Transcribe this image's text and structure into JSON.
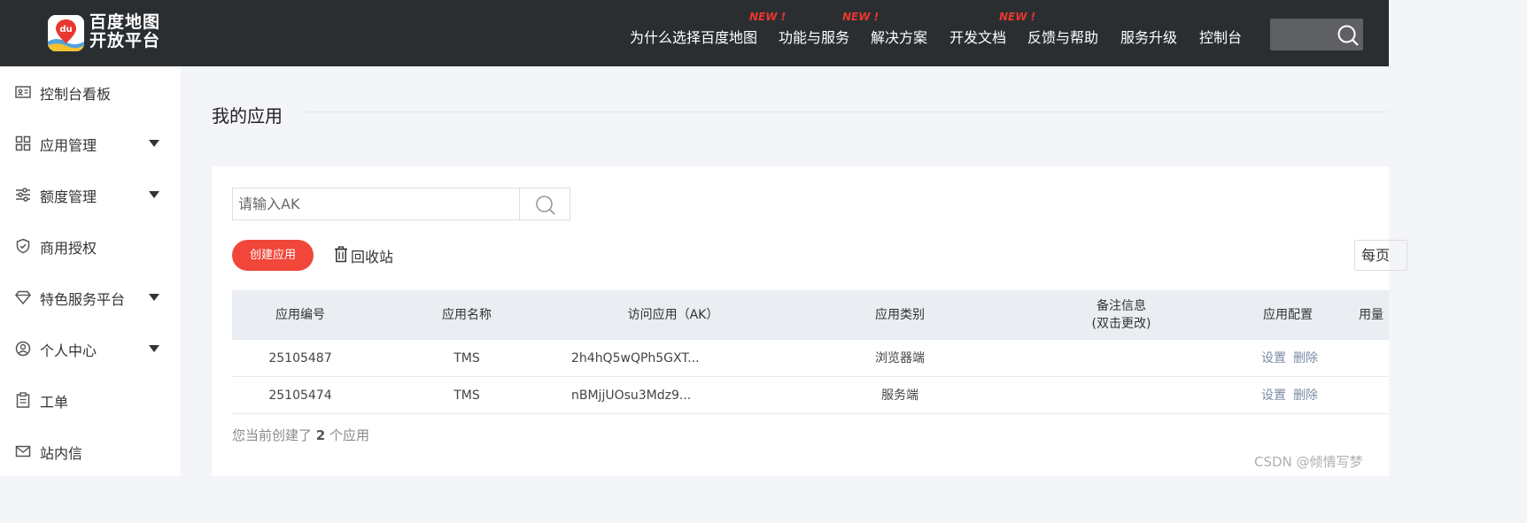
{
  "header": {
    "logo_text_line1": "百度地图",
    "logo_text_line2": "开放平台",
    "nav": [
      {
        "label": "为什么选择百度地图",
        "badge": ""
      },
      {
        "label": "功能与服务",
        "badge": "NEW !"
      },
      {
        "label": "解决方案",
        "badge": "NEW !"
      },
      {
        "label": "开发文档",
        "badge": "NEW !"
      },
      {
        "label": "反馈与帮助",
        "badge": ""
      },
      {
        "label": "服务升级",
        "badge": ""
      },
      {
        "label": "控制台",
        "badge": ""
      }
    ],
    "search_icon": "search-icon"
  },
  "sidebar": {
    "items": [
      {
        "label": "控制台看板",
        "icon": "dashboard-card-icon",
        "expandable": false
      },
      {
        "label": "应用管理",
        "icon": "grid-icon",
        "expandable": true
      },
      {
        "label": "额度管理",
        "icon": "sliders-icon",
        "expandable": true
      },
      {
        "label": "商用授权",
        "icon": "shield-check-icon",
        "expandable": false
      },
      {
        "label": "特色服务平台",
        "icon": "diamond-icon",
        "expandable": true
      },
      {
        "label": "个人中心",
        "icon": "user-circle-icon",
        "expandable": true
      },
      {
        "label": "工单",
        "icon": "clipboard-icon",
        "expandable": false
      },
      {
        "label": "站内信",
        "icon": "mail-icon",
        "expandable": false
      }
    ]
  },
  "main": {
    "title": "我的应用",
    "search": {
      "placeholder": "请输入AK"
    },
    "create_button": "创建应用",
    "recycle_bin": "回收站",
    "per_page": "每页",
    "table": {
      "headers": [
        "应用编号",
        "应用名称",
        "访问应用（AK）",
        "应用类别",
        "备注信息",
        "应用配置",
        "用量"
      ],
      "remark_header_line1": "备注信息",
      "remark_header_line2": "(双击更改)",
      "rows": [
        {
          "id": "25105487",
          "name": "TMS",
          "ak": "2h4hQ5wQPh5GXT...",
          "type": "浏览器端",
          "remark": "",
          "op_settings": "设置",
          "op_delete": "删除"
        },
        {
          "id": "25105474",
          "name": "TMS",
          "ak": "nBMjjUOsu3Mdz9...",
          "type": "服务端",
          "remark": "",
          "op_settings": "设置",
          "op_delete": "删除"
        }
      ]
    },
    "count_prefix": "您当前创建了",
    "count_value": "2",
    "count_suffix": "个应用"
  },
  "watermark": "CSDN @倾情写梦",
  "colors": {
    "topbar": "#2b2e31",
    "accent": "#f0473a",
    "new_badge": "#e8382f",
    "link": "#7c8ba7"
  }
}
